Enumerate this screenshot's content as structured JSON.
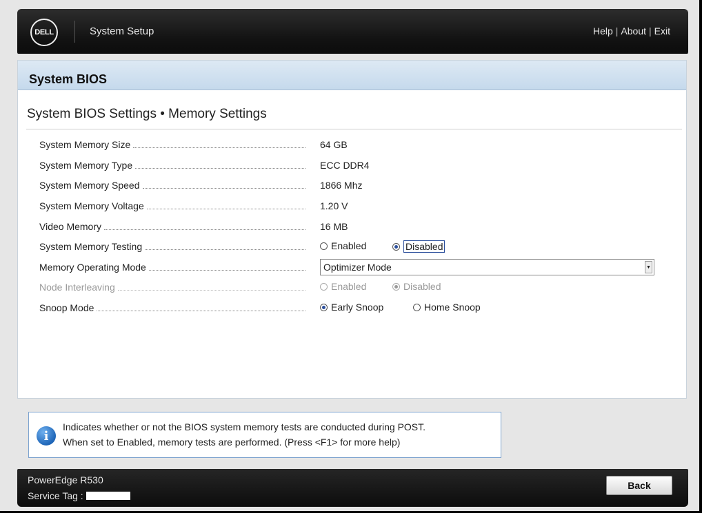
{
  "header": {
    "logo_text": "DELL",
    "app_title": "System Setup",
    "links": [
      "Help",
      "About",
      "Exit"
    ],
    "separator": "|"
  },
  "panel": {
    "title": "System BIOS",
    "breadcrumb": "System BIOS Settings • Memory Settings"
  },
  "settings": {
    "memory_size": {
      "label": "System Memory Size",
      "value": "64 GB"
    },
    "memory_type": {
      "label": "System Memory Type",
      "value": "ECC DDR4"
    },
    "memory_speed": {
      "label": "System Memory Speed",
      "value": "1866 Mhz"
    },
    "memory_voltage": {
      "label": "System Memory Voltage",
      "value": "1.20 V"
    },
    "video_memory": {
      "label": "Video Memory",
      "value": "16 MB"
    },
    "memory_testing": {
      "label": "System Memory Testing",
      "options": [
        "Enabled",
        "Disabled"
      ],
      "selected": "Disabled"
    },
    "operating_mode": {
      "label": "Memory Operating Mode",
      "value": "Optimizer Mode"
    },
    "node_interleaving": {
      "label": "Node Interleaving",
      "options": [
        "Enabled",
        "Disabled"
      ],
      "selected": "Disabled",
      "disabled": true
    },
    "snoop_mode": {
      "label": "Snoop Mode",
      "options": [
        "Early Snoop",
        "Home Snoop"
      ],
      "selected": "Early Snoop"
    }
  },
  "info": {
    "icon": "info-icon",
    "line1": "Indicates whether or not the BIOS system memory tests are conducted during POST.",
    "line2": "When set to Enabled, memory tests are performed. (Press <F1> for more help)"
  },
  "footer": {
    "model": "PowerEdge R530",
    "service_tag_label": "Service Tag :",
    "back_label": "Back"
  },
  "colors": {
    "header_bg": "#121212",
    "title_bar": "#c5d9ec",
    "radio_selected": "#2b4f9c",
    "info_border": "#7da3cf"
  }
}
